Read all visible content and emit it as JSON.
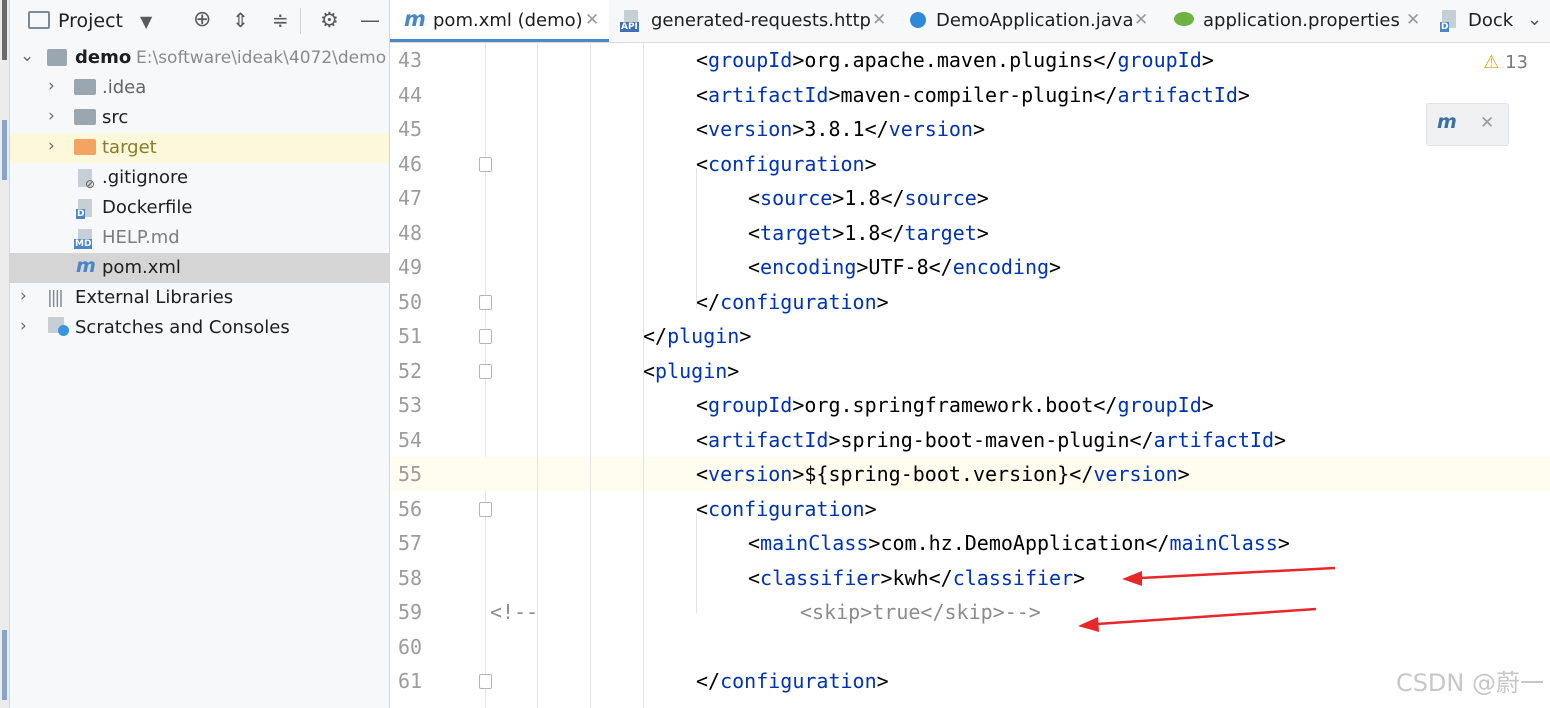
{
  "project_panel": {
    "title": "Project",
    "tree": [
      {
        "label": "demo",
        "path": "E:\\software\\ideak\\4072\\demo"
      },
      {
        "label": ".idea"
      },
      {
        "label": "src"
      },
      {
        "label": "target"
      },
      {
        "label": ".gitignore"
      },
      {
        "label": "Dockerfile"
      },
      {
        "label": "HELP.md",
        "badge": "MD"
      },
      {
        "label": "pom.xml"
      },
      {
        "label": "External Libraries"
      },
      {
        "label": "Scratches and Consoles"
      }
    ]
  },
  "tabs": [
    {
      "label": "pom.xml (demo)",
      "active": true
    },
    {
      "label": "generated-requests.http",
      "badge": "API"
    },
    {
      "label": "DemoApplication.java"
    },
    {
      "label": "application.properties"
    },
    {
      "label": "Dock"
    }
  ],
  "editor": {
    "warning_count": "13",
    "lines": [
      {
        "num": "43",
        "segments": [
          {
            "t": "<",
            "c": "p"
          },
          {
            "t": "groupId",
            "c": "tag"
          },
          {
            "t": ">org.apache.maven.plugins</",
            "c": "p"
          },
          {
            "t": "groupId",
            "c": "tag"
          },
          {
            "t": ">",
            "c": "p"
          }
        ]
      },
      {
        "num": "44",
        "segments": [
          {
            "t": "<",
            "c": "p"
          },
          {
            "t": "artifactId",
            "c": "tag"
          },
          {
            "t": ">maven-compiler-plugin</",
            "c": "p"
          },
          {
            "t": "artifactId",
            "c": "tag"
          },
          {
            "t": ">",
            "c": "p"
          }
        ]
      },
      {
        "num": "45",
        "segments": [
          {
            "t": "<",
            "c": "p"
          },
          {
            "t": "version",
            "c": "tag"
          },
          {
            "t": ">3.8.1</",
            "c": "p"
          },
          {
            "t": "version",
            "c": "tag"
          },
          {
            "t": ">",
            "c": "p"
          }
        ]
      },
      {
        "num": "46",
        "segments": [
          {
            "t": "<",
            "c": "p"
          },
          {
            "t": "configuration",
            "c": "tag"
          },
          {
            "t": ">",
            "c": "p"
          }
        ]
      },
      {
        "num": "47",
        "segments": [
          {
            "t": "<",
            "c": "p"
          },
          {
            "t": "source",
            "c": "tag"
          },
          {
            "t": ">1.8</",
            "c": "p"
          },
          {
            "t": "source",
            "c": "tag"
          },
          {
            "t": ">",
            "c": "p"
          }
        ]
      },
      {
        "num": "48",
        "segments": [
          {
            "t": "<",
            "c": "p"
          },
          {
            "t": "target",
            "c": "tag"
          },
          {
            "t": ">1.8</",
            "c": "p"
          },
          {
            "t": "target",
            "c": "tag"
          },
          {
            "t": ">",
            "c": "p"
          }
        ]
      },
      {
        "num": "49",
        "segments": [
          {
            "t": "<",
            "c": "p"
          },
          {
            "t": "encoding",
            "c": "tag"
          },
          {
            "t": ">UTF-8</",
            "c": "p"
          },
          {
            "t": "encoding",
            "c": "tag"
          },
          {
            "t": ">",
            "c": "p"
          }
        ]
      },
      {
        "num": "50",
        "segments": [
          {
            "t": "</",
            "c": "p"
          },
          {
            "t": "configuration",
            "c": "tag"
          },
          {
            "t": ">",
            "c": "p"
          }
        ]
      },
      {
        "num": "51",
        "segments": [
          {
            "t": "</",
            "c": "p"
          },
          {
            "t": "plugin",
            "c": "tag"
          },
          {
            "t": ">",
            "c": "p"
          }
        ]
      },
      {
        "num": "52",
        "segments": [
          {
            "t": "<",
            "c": "p"
          },
          {
            "t": "plugin",
            "c": "tag"
          },
          {
            "t": ">",
            "c": "p"
          }
        ]
      },
      {
        "num": "53",
        "segments": [
          {
            "t": "<",
            "c": "p"
          },
          {
            "t": "groupId",
            "c": "tag"
          },
          {
            "t": ">org.springframework.boot</",
            "c": "p"
          },
          {
            "t": "groupId",
            "c": "tag"
          },
          {
            "t": ">",
            "c": "p"
          }
        ]
      },
      {
        "num": "54",
        "segments": [
          {
            "t": "<",
            "c": "p"
          },
          {
            "t": "artifactId",
            "c": "tag"
          },
          {
            "t": ">spring-boot-maven-plugin</",
            "c": "p"
          },
          {
            "t": "artifactId",
            "c": "tag"
          },
          {
            "t": ">",
            "c": "p"
          }
        ]
      },
      {
        "num": "55",
        "segments": [
          {
            "t": "<",
            "c": "p"
          },
          {
            "t": "version",
            "c": "tag"
          },
          {
            "t": ">${spring-boot.version}</",
            "c": "p"
          },
          {
            "t": "version",
            "c": "tag"
          },
          {
            "t": ">",
            "c": "p"
          }
        ]
      },
      {
        "num": "56",
        "segments": [
          {
            "t": "<",
            "c": "p"
          },
          {
            "t": "configuration",
            "c": "tag"
          },
          {
            "t": ">",
            "c": "p"
          }
        ]
      },
      {
        "num": "57",
        "segments": [
          {
            "t": "<",
            "c": "p"
          },
          {
            "t": "mainClass",
            "c": "tag"
          },
          {
            "t": ">com.hz.DemoApplication</",
            "c": "p"
          },
          {
            "t": "mainClass",
            "c": "tag"
          },
          {
            "t": ">",
            "c": "p"
          }
        ]
      },
      {
        "num": "58",
        "segments": [
          {
            "t": "<",
            "c": "p"
          },
          {
            "t": "classifier",
            "c": "tag"
          },
          {
            "t": ">kwh</",
            "c": "p"
          },
          {
            "t": "classifier",
            "c": "tag"
          },
          {
            "t": ">",
            "c": "p"
          }
        ]
      },
      {
        "num": "59",
        "segments": [
          {
            "t": "<!--",
            "c": "comment"
          },
          {
            "t": "<skip>true</skip>-->",
            "c": "comment"
          }
        ]
      },
      {
        "num": "60",
        "segments": []
      },
      {
        "num": "61",
        "segments": [
          {
            "t": "</",
            "c": "p"
          },
          {
            "t": "configuration",
            "c": "tag"
          },
          {
            "t": ">",
            "c": "p"
          }
        ]
      }
    ]
  },
  "watermark": "CSDN @蔚一",
  "colors": {
    "tag": "#0033b3",
    "comment": "#8c8c8c",
    "annotation_arrow": "#e8272a",
    "active_tab_underline": "#4a88c7"
  }
}
